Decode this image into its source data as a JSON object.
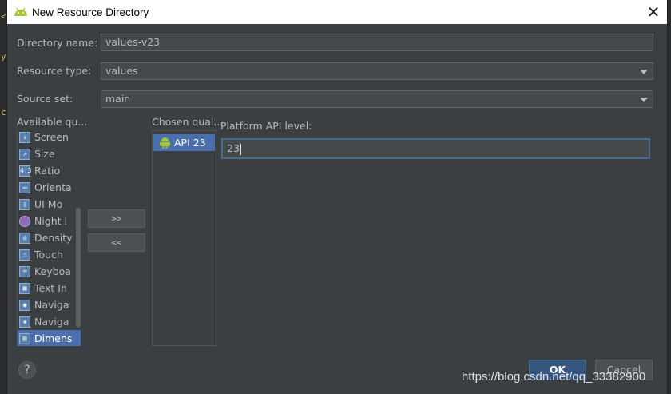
{
  "window": {
    "title": "New Resource Directory",
    "close_glyph": "✕"
  },
  "form": {
    "directory_name_label": "Directory name:",
    "directory_name_value": "values-v23",
    "resource_type_label": "Resource type:",
    "resource_type_value": "values",
    "source_set_label": "Source set:",
    "source_set_value": "main"
  },
  "available": {
    "header": "Available qu...",
    "items": [
      {
        "label": "Screen",
        "icon": "screen-icon"
      },
      {
        "label": "Size",
        "icon": "size-icon"
      },
      {
        "label": "Ratio",
        "icon": "ratio-icon"
      },
      {
        "label": "Orienta",
        "icon": "orientation-icon"
      },
      {
        "label": "UI Mo",
        "icon": "ui-mode-icon"
      },
      {
        "label": "Night I",
        "icon": "night-mode-icon"
      },
      {
        "label": "Density",
        "icon": "density-icon"
      },
      {
        "label": "Touch",
        "icon": "touch-icon"
      },
      {
        "label": "Keyboa",
        "icon": "keyboard-icon"
      },
      {
        "label": "Text In",
        "icon": "text-input-icon"
      },
      {
        "label": "Naviga",
        "icon": "navigation-state-icon"
      },
      {
        "label": "Naviga",
        "icon": "navigation-method-icon"
      },
      {
        "label": "Dimens",
        "icon": "dimension-icon"
      }
    ],
    "selected_index": 12
  },
  "buttons": {
    "add": ">>",
    "remove": "<<",
    "ok": "OK",
    "cancel": "Cancel",
    "help": "?"
  },
  "chosen": {
    "header": "Chosen qual...",
    "items": [
      {
        "label": "API 23",
        "icon": "android-icon"
      }
    ]
  },
  "platform": {
    "label": "Platform API level:",
    "value": "23"
  },
  "watermark": "https://blog.csdn.net/qq_33382900",
  "colors": {
    "background": "#3c3f41",
    "field": "#45494a",
    "selection": "#4b6eaf",
    "focus_border": "#466d94",
    "ok_button": "#365880",
    "android_green": "#a4c639"
  }
}
